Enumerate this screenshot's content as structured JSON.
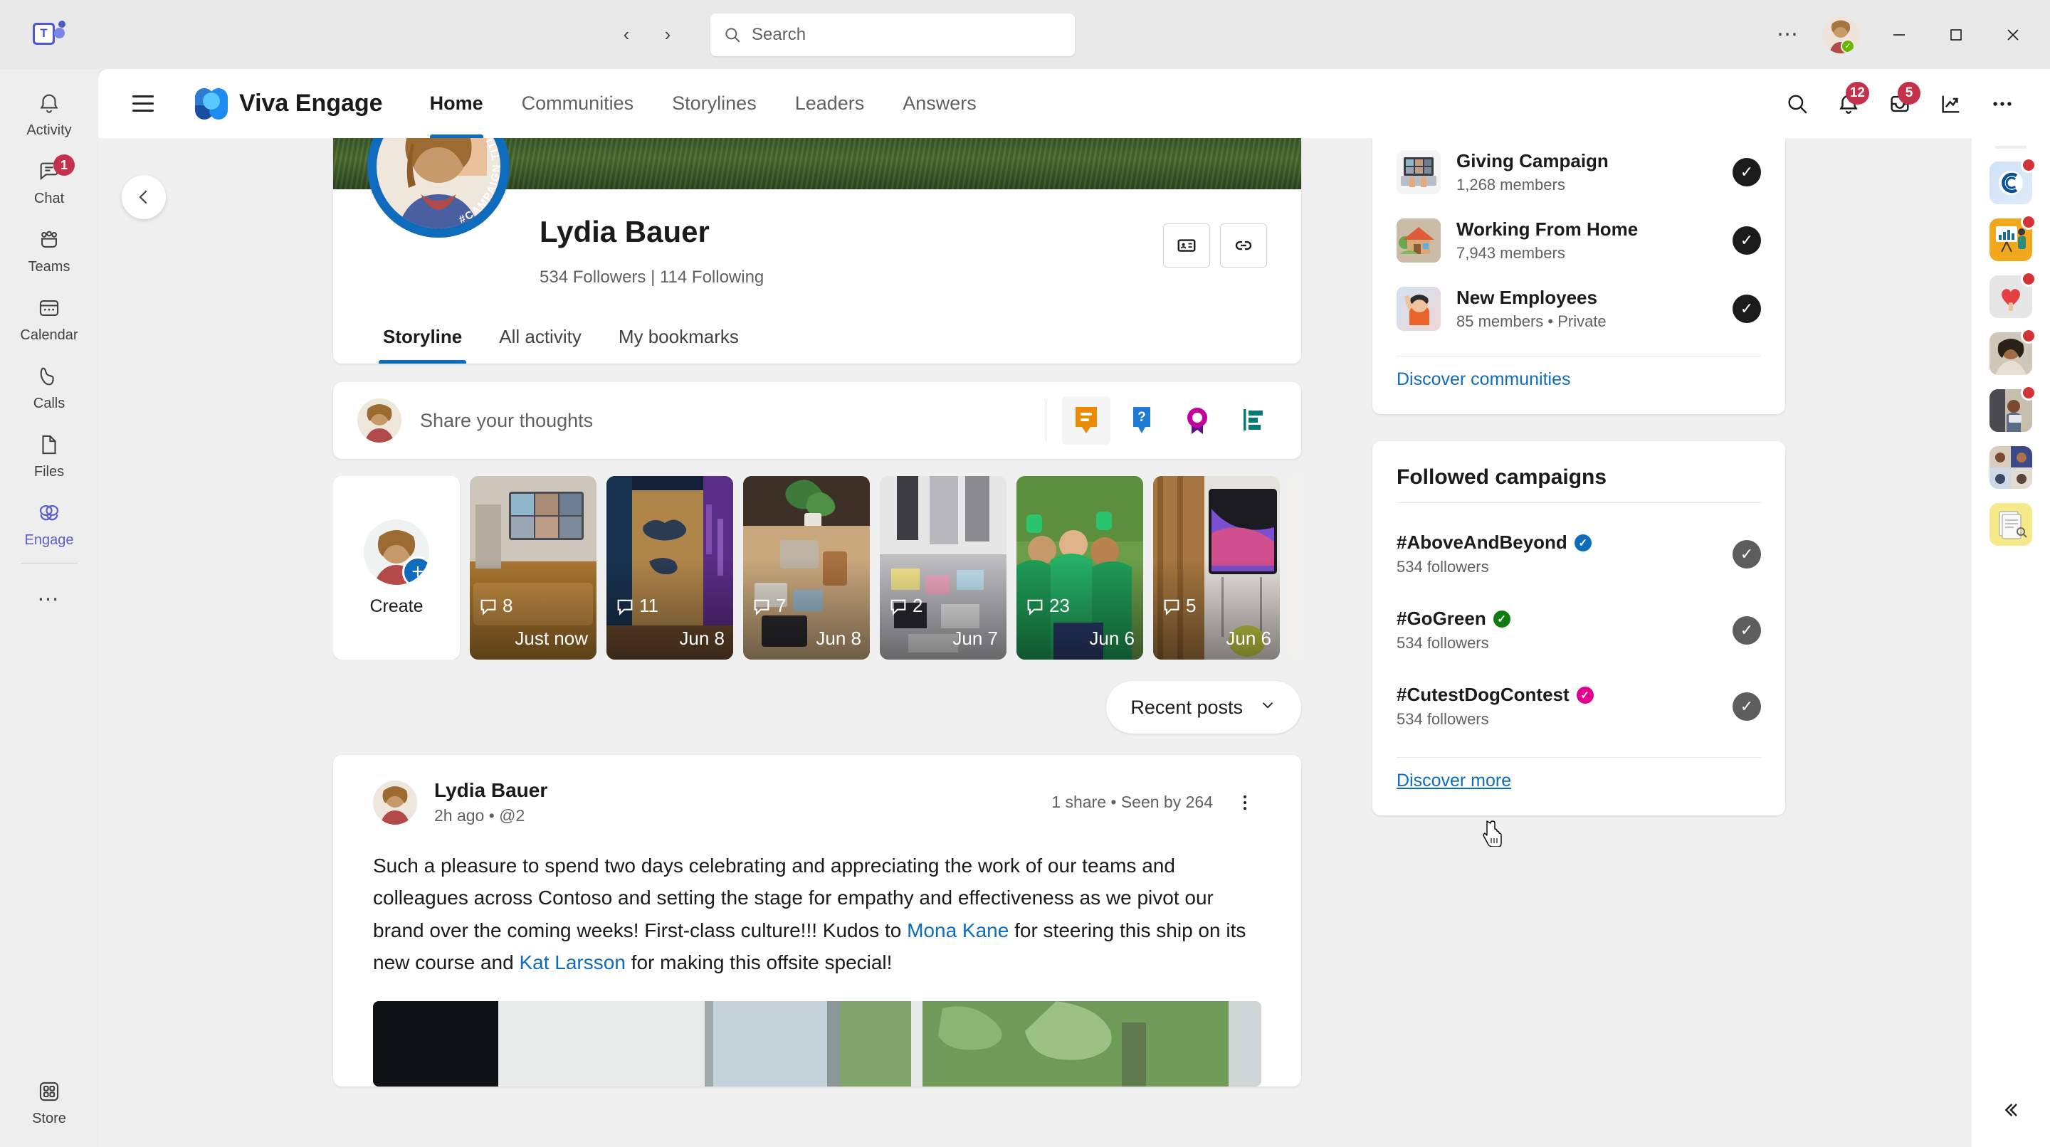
{
  "titlebar": {
    "app_logo": "teams-logo",
    "back_icon": "chevron-left-icon",
    "forward_icon": "chevron-right-icon",
    "search_placeholder": "Search",
    "search_value": "",
    "more_label": "…",
    "presence": "available",
    "minimize_label": "—",
    "maximize_label": "□",
    "close_label": "✕"
  },
  "left_rail": {
    "items": [
      {
        "label": "Activity",
        "icon": "bell-icon",
        "badge": "",
        "active": false
      },
      {
        "label": "Chat",
        "icon": "chat-icon",
        "badge": "1",
        "active": false
      },
      {
        "label": "Teams",
        "icon": "teams-people-icon",
        "badge": "",
        "active": false
      },
      {
        "label": "Calendar",
        "icon": "calendar-icon",
        "badge": "",
        "active": false
      },
      {
        "label": "Calls",
        "icon": "phone-icon",
        "badge": "",
        "active": false
      },
      {
        "label": "Files",
        "icon": "file-icon",
        "badge": "",
        "active": false
      },
      {
        "label": "Engage",
        "icon": "engage-icon",
        "badge": "",
        "active": true
      }
    ],
    "more_label": "…",
    "store_label": "Store",
    "store_icon": "grid-apps-icon"
  },
  "engage_header": {
    "menu_icon": "hamburger-menu-icon",
    "brand": "Viva Engage",
    "brand_icon": "viva-engage-logo",
    "tabs": [
      {
        "label": "Home",
        "active": true
      },
      {
        "label": "Communities",
        "active": false
      },
      {
        "label": "Storylines",
        "active": false
      },
      {
        "label": "Leaders",
        "active": false
      },
      {
        "label": "Answers",
        "active": false
      }
    ],
    "actions": [
      {
        "name": "search-icon",
        "badge": ""
      },
      {
        "name": "notifications-bell-icon",
        "badge": "12"
      },
      {
        "name": "inbox-icon",
        "badge": "5"
      },
      {
        "name": "analytics-trend-icon",
        "badge": ""
      },
      {
        "name": "more-options-icon",
        "badge": ""
      }
    ]
  },
  "content": {
    "back_button_icon": "chevron-left-icon"
  },
  "profile": {
    "name": "Lydia Bauer",
    "stats": "534 Followers |  114 Following",
    "followers": "534 Followers",
    "following": "114 Following",
    "campaign_ring_text": "#CAMPAIGN TITLE",
    "actions": [
      {
        "name": "contact-card-icon"
      },
      {
        "name": "copy-link-icon"
      }
    ],
    "tabs": [
      {
        "label": "Storyline",
        "active": true
      },
      {
        "label": "All activity",
        "active": false
      },
      {
        "label": "My bookmarks",
        "active": false
      }
    ]
  },
  "composer": {
    "placeholder": "Share your thoughts",
    "tools": [
      {
        "name": "discussion-post-icon",
        "selected": true
      },
      {
        "name": "question-post-icon",
        "selected": false
      },
      {
        "name": "praise-post-icon",
        "selected": false
      },
      {
        "name": "poll-post-icon",
        "selected": false
      }
    ]
  },
  "stories": {
    "create_label": "Create",
    "create_icon": "plus-icon",
    "items": [
      {
        "comments": "8",
        "date": "Just now",
        "theme": "meeting-room"
      },
      {
        "comments": "11",
        "date": "Jun 8",
        "theme": "world-map-wall"
      },
      {
        "comments": "7",
        "date": "Jun 8",
        "theme": "office-plant"
      },
      {
        "comments": "2",
        "date": "Jun 7",
        "theme": "workshop-table"
      },
      {
        "comments": "23",
        "date": "Jun 6",
        "theme": "volunteers"
      },
      {
        "comments": "5",
        "date": "Jun 6",
        "theme": "conference-display"
      },
      {
        "comments": "",
        "date": "",
        "theme": "partial"
      }
    ]
  },
  "sort": {
    "label": "Recent posts",
    "chevron_icon": "chevron-down-icon"
  },
  "post": {
    "author": "Lydia Bauer",
    "meta": "2h ago  •  @2",
    "time": "2h ago",
    "audience": "@2",
    "shares": "1 share",
    "seen": "Seen by 264",
    "stats": "1 share  •  Seen by 264",
    "kebab_icon": "more-vertical-icon",
    "body_part1": "Such a pleasure to spend two days celebrating and appreciating the work of our teams and colleagues across Contoso and setting the stage for empathy and effectiveness as we pivot our brand over the coming weeks! First-class culture!!! Kudos to ",
    "mention1": "Mona Kane",
    "body_part2": " for steering this ship on its new course and ",
    "mention2": "Kat Larsson",
    "body_part3": " for making this offsite special!"
  },
  "communities": {
    "items": [
      {
        "name": "Giving Campaign",
        "sub": "1,268 members",
        "icon": "laptop-hands-emoji",
        "joined": true
      },
      {
        "name": "Working From Home",
        "sub": "7,943 members",
        "icon": "house-emoji",
        "joined": true
      },
      {
        "name": "New Employees",
        "sub": "85 members • Private",
        "icon": "raising-hand-emoji",
        "joined": true
      }
    ],
    "discover_label": "Discover communities",
    "check_icon": "check-icon"
  },
  "campaigns": {
    "title": "Followed campaigns",
    "items": [
      {
        "name": "#AboveAndBeyond",
        "sub": "534 followers",
        "badge_color": "#0f6cbd",
        "followed": true
      },
      {
        "name": "#GoGreen",
        "sub": "534 followers",
        "badge_color": "#107c10",
        "followed": true
      },
      {
        "name": "#CutestDogContest",
        "sub": "534 followers",
        "badge_color": "#e3008c",
        "followed": true
      }
    ],
    "discover_label": "Discover more",
    "check_icon": "check-icon"
  },
  "far_rail": {
    "avatar_name": "user-avatar",
    "apps": [
      {
        "name": "connections-app-icon",
        "badge": true,
        "glyph": "C"
      },
      {
        "name": "learning-app-icon",
        "badge": true,
        "glyph": "📊"
      },
      {
        "name": "praise-heart-app-icon",
        "badge": true,
        "glyph": "❤"
      },
      {
        "name": "people-app-icon",
        "badge": true,
        "glyph": "👩"
      },
      {
        "name": "insights-app-icon",
        "badge": true,
        "glyph": "💻"
      },
      {
        "name": "meeting-grid-app-icon",
        "badge": false,
        "glyph": "⬚"
      },
      {
        "name": "approvals-app-icon",
        "badge": false,
        "glyph": "📄"
      }
    ],
    "collapse_icon": "chevron-double-left-icon"
  },
  "colors": {
    "accent": "#0f6cbd",
    "brand_purple": "#5b5fc7",
    "badge_red": "#c4314b",
    "presence_green": "#6bb700"
  }
}
